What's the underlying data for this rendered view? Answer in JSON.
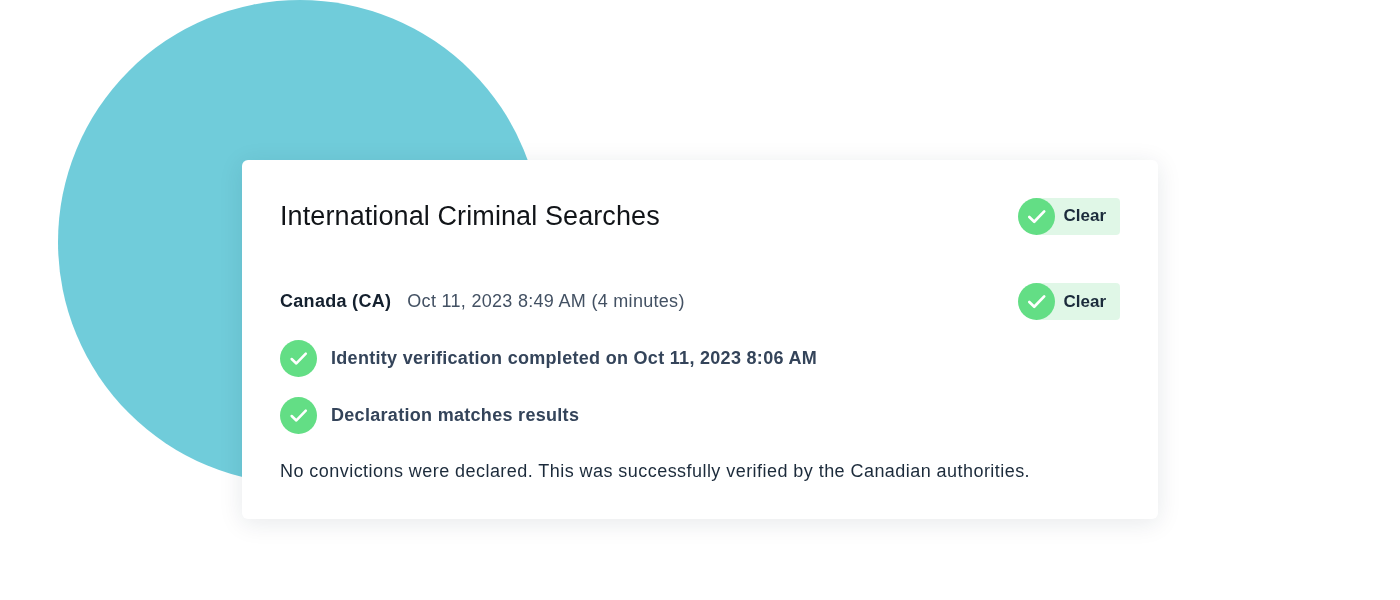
{
  "card": {
    "title": "International Criminal Searches",
    "status": {
      "label": "Clear",
      "kind": "clear"
    }
  },
  "searches": [
    {
      "country": "Canada (CA)",
      "timestamp": "Oct 11, 2023 8:49 AM (4 minutes)",
      "status": {
        "label": "Clear",
        "kind": "clear"
      },
      "checks": [
        {
          "text": "Identity verification completed on Oct 11, 2023 8:06 AM",
          "passed": true
        },
        {
          "text": "Declaration matches results",
          "passed": true
        }
      ],
      "note": "No convictions were declared. This was successfully verified by the Canadian authorities."
    }
  ]
}
